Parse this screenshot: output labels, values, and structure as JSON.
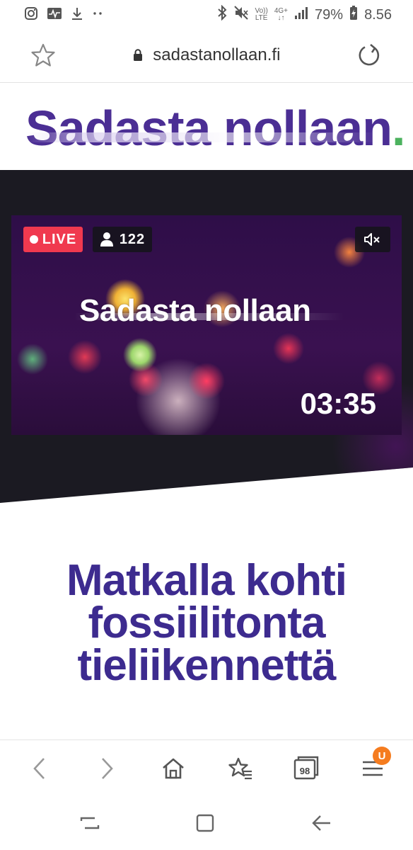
{
  "status_bar": {
    "left_icons": [
      "instagram-icon",
      "activity-icon",
      "download-icon",
      "more-dots-icon"
    ],
    "right_icons": [
      "bluetooth-icon",
      "mute-icon",
      "volte-icon",
      "4g-icon",
      "signal-icon",
      "battery-icon"
    ],
    "volte_top": "Vo))",
    "volte_bottom": "LTE",
    "network_top": "4G+",
    "network_bottom": "↓↑",
    "battery": "79%",
    "time": "8.56"
  },
  "address_bar": {
    "url": "sadastanollaan.fi"
  },
  "site": {
    "logo_text": "Sadasta nollaan",
    "logo_dot": "."
  },
  "video": {
    "live_label": "LIVE",
    "viewer_count": "122",
    "title": "Sadasta nollaan",
    "timer": "03:35"
  },
  "content": {
    "headline_lines": [
      "Matkalla kohti",
      "fossiilitonta",
      "tieliikennettä"
    ]
  },
  "toolbar": {
    "tabs_count": "98",
    "menu_badge": "U"
  },
  "colors": {
    "brand_purple": "#4b2e94",
    "heading_purple": "#3d2b8f",
    "logo_dot_green": "#4cb25e",
    "live_red": "#f0394f",
    "badge_orange": "#f57c1f"
  }
}
